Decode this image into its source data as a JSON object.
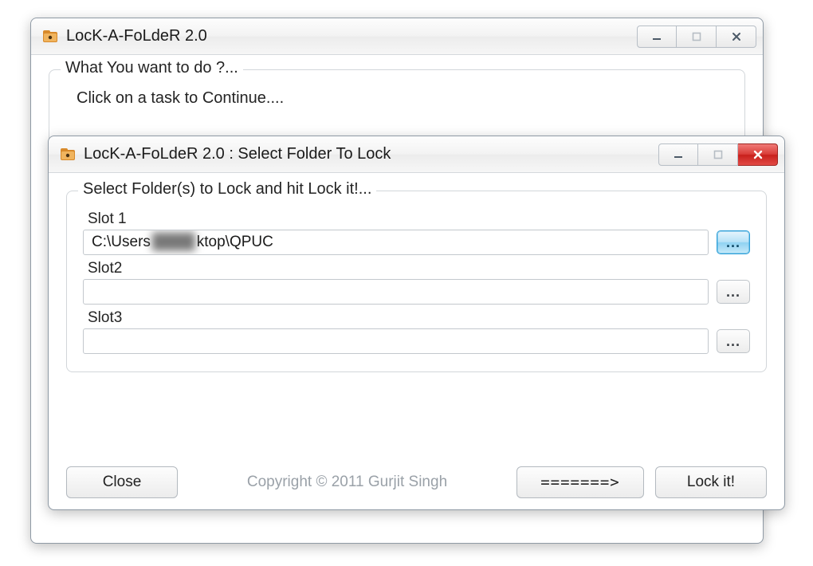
{
  "mainWindow": {
    "title": "LocK-A-FoLdeR 2.0",
    "group": {
      "legend": "What You want to do ?...",
      "subtext": "Click on a task to Continue...."
    }
  },
  "dialog": {
    "title": "LocK-A-FoLdeR 2.0 : Select Folder To Lock",
    "group": {
      "legend": "Select Folder(s) to Lock and hit Lock it!..."
    },
    "slots": [
      {
        "label": "Slot 1",
        "prefix": "C:\\Users",
        "redacted": "████",
        "suffix": "ktop\\QPUC",
        "browseHot": true
      },
      {
        "label": "Slot2",
        "prefix": "",
        "redacted": "",
        "suffix": "",
        "browseHot": false
      },
      {
        "label": "Slot3",
        "prefix": "",
        "redacted": "",
        "suffix": "",
        "browseHot": false
      }
    ],
    "close_label": "Close",
    "copyright": "Copyright © 2011 Gurjit Singh",
    "arrow_label": "=======>",
    "lock_label": "Lock it!",
    "browse_ellipsis": "..."
  }
}
